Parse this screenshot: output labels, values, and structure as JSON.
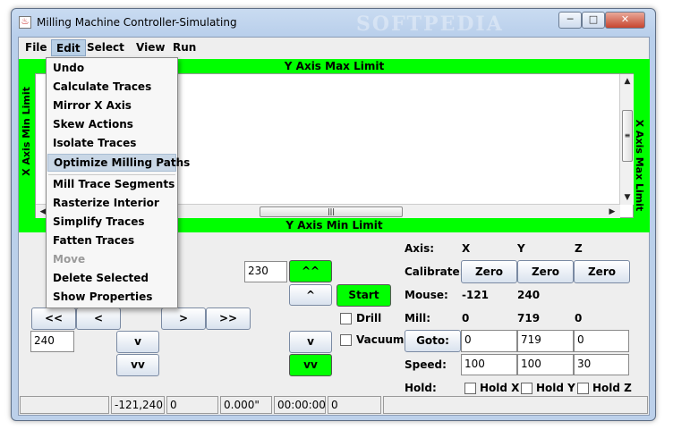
{
  "window": {
    "title": "Milling Machine Controller-Simulating",
    "watermark": "SOFTPEDIA",
    "minimize": "─",
    "maximize": "□",
    "close": "✕"
  },
  "menubar": {
    "items": [
      "File",
      "Edit",
      "Select",
      "View",
      "Run"
    ]
  },
  "edit_menu": {
    "items": [
      {
        "label": "Undo",
        "enabled": true
      },
      {
        "label": "Calculate Traces",
        "enabled": true
      },
      {
        "label": "Mirror X Axis",
        "enabled": true
      },
      {
        "label": "Skew Actions",
        "enabled": true
      },
      {
        "label": "Isolate Traces",
        "enabled": true
      },
      {
        "label": "Optimize Milling Paths",
        "enabled": true,
        "highlighted": true
      },
      {
        "label": "Mill Trace Segments",
        "enabled": true
      },
      {
        "label": "Rasterize Interior",
        "enabled": true
      },
      {
        "label": "Simplify Traces",
        "enabled": true
      },
      {
        "label": "Fatten Traces",
        "enabled": true
      },
      {
        "label": "Move",
        "enabled": false
      },
      {
        "label": "Delete Selected",
        "enabled": true
      },
      {
        "label": "Show Properties",
        "enabled": true
      }
    ]
  },
  "limits": {
    "y_max": "Y Axis Max Limit",
    "y_min": "Y Axis Min Limit",
    "x_min": "X Axis Min Limit",
    "x_max": "X Axis Max Limit"
  },
  "controls": {
    "y_step_value": "230",
    "x_step_value": "240",
    "up_fast": "^^",
    "up": "^",
    "down": "v",
    "down_fast": "vv",
    "left_fast": "<<",
    "left": "<",
    "right": ">",
    "right_fast": ">>",
    "y_down": "v",
    "y_down_fast": "vv",
    "z_down": "v",
    "z_down_fast": "vv",
    "start": "Start",
    "drill": "Drill",
    "vacuum": "Vacuum"
  },
  "axis_panel": {
    "axis_label": "Axis:",
    "axes": [
      "X",
      "Y",
      "Z"
    ],
    "calibrate_label": "Calibrate:",
    "calibrate_buttons": [
      "Zero",
      "Zero",
      "Zero"
    ],
    "mouse_label": "Mouse:",
    "mouse_values": [
      "-121",
      "240"
    ],
    "mill_label": "Mill:",
    "mill_values": [
      "0",
      "719",
      "0"
    ],
    "goto_label": "Goto:",
    "goto_values": [
      "0",
      "719",
      "0"
    ],
    "speed_label": "Speed:",
    "speed_values": [
      "100",
      "100",
      "30"
    ],
    "hold_label": "Hold:",
    "hold_options": [
      "Hold X",
      "Hold Y",
      "Hold Z"
    ]
  },
  "status": {
    "cells": [
      "",
      "-121,240",
      "0",
      "0.000\"",
      "00:00:00",
      "0",
      ""
    ]
  },
  "colors": {
    "limit_green": "#00ff00",
    "menu_highlight": "#c9d7e6"
  }
}
